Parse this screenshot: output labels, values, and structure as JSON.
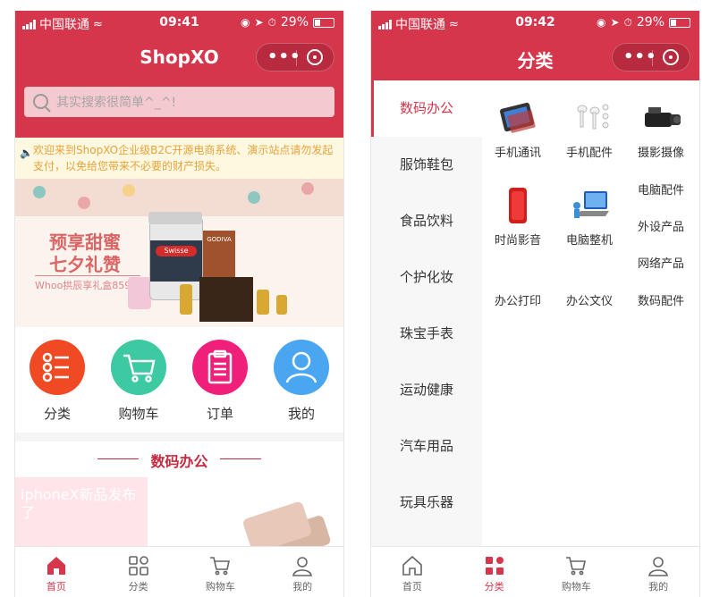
{
  "status_bar": {
    "carrier": "中国联通",
    "battery": "29%"
  },
  "left": {
    "time": "09:41",
    "nav_title": "ShopXO",
    "search_placeholder": "其实搜索很简单^_^!",
    "notice": "欢迎来到ShopXO企业级B2C开源电商系统、演示站点请勿发起支付，以免给您带来不必要的财产损失。",
    "banner": {
      "line1": "预享甜蜜",
      "line2": "七夕礼赞",
      "line3": "Whoo拱辰享礼盒859元",
      "brand": "Swisse",
      "brand2": "GODIVA"
    },
    "quick_nav": [
      {
        "label": "分类",
        "color": "#f04a24"
      },
      {
        "label": "购物车",
        "color": "#3dc9a1"
      },
      {
        "label": "订单",
        "color": "#f0207a"
      },
      {
        "label": "我的",
        "color": "#4aa6f0"
      }
    ],
    "floor_title": "数码办公",
    "promo_text": "iphoneX新品发布了",
    "tabs": [
      {
        "label": "首页",
        "icon": "home-icon"
      },
      {
        "label": "分类",
        "icon": "category-icon"
      },
      {
        "label": "购物车",
        "icon": "cart-icon"
      },
      {
        "label": "我的",
        "icon": "user-icon"
      }
    ],
    "active_tab": 0
  },
  "right": {
    "time": "09:42",
    "nav_title": "分类",
    "sidebar": [
      "数码办公",
      "服饰鞋包",
      "食品饮料",
      "个护化妆",
      "珠宝手表",
      "运动健康",
      "汽车用品",
      "玩具乐器"
    ],
    "active_category": 0,
    "subcategories": [
      "手机通讯",
      "手机配件",
      "摄影摄像",
      "电脑配件",
      "时尚影音",
      "电脑整机",
      "外设产品",
      "网络产品",
      "办公打印",
      "办公文仪",
      "数码配件"
    ],
    "tabs": [
      {
        "label": "首页",
        "icon": "home-icon"
      },
      {
        "label": "分类",
        "icon": "category-icon"
      },
      {
        "label": "购物车",
        "icon": "cart-icon"
      },
      {
        "label": "我的",
        "icon": "user-icon"
      }
    ],
    "active_tab": 1
  },
  "colors": {
    "brand": "#d6364c",
    "notice_text": "#e4a33b",
    "floor_accent": "#c52a3f"
  }
}
